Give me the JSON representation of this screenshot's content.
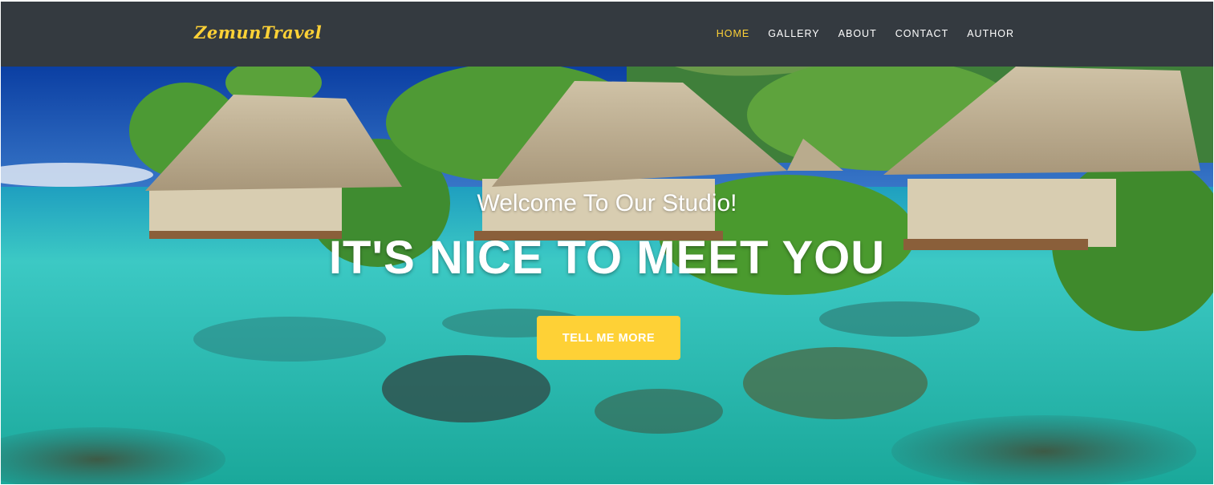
{
  "brand": {
    "name": "ZemunTravel",
    "color": "#fed136"
  },
  "nav": {
    "items": [
      {
        "label": "HOME",
        "active": true
      },
      {
        "label": "GALLERY",
        "active": false
      },
      {
        "label": "ABOUT",
        "active": false
      },
      {
        "label": "CONTACT",
        "active": false
      },
      {
        "label": "AUTHOR",
        "active": false
      }
    ],
    "background": "#343a40"
  },
  "hero": {
    "subheading": "Welcome To Our Studio!",
    "heading": "IT'S NICE TO MEET YOU",
    "cta_label": "TELL ME MORE",
    "accent": "#fed136",
    "image": "tropical-lagoon-bungalows"
  }
}
